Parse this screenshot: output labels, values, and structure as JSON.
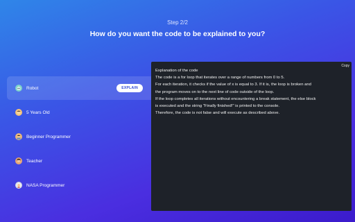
{
  "header": {
    "step": "Step 2/2",
    "question": "How do you want the code to be explained to you?"
  },
  "options": [
    {
      "label": "Robot",
      "icon": "robot-icon",
      "active": true
    },
    {
      "label": "5 Years Old",
      "icon": "child-icon",
      "active": false
    },
    {
      "label": "Beginner Programmer",
      "icon": "beginner-programmer-icon",
      "active": false
    },
    {
      "label": "Teacher",
      "icon": "teacher-icon",
      "active": false
    },
    {
      "label": "NASA Programmer",
      "icon": "astronaut-icon",
      "active": false
    }
  ],
  "explain_button": "EXPLAIN",
  "panel": {
    "copy_label": "Copy",
    "lines": [
      "Explanation of the code",
      "The code is a for loop that iterates over a range of numbers from 0 to 5.",
      "For each iteration, it checks if the value of x is equal to 3. If it is, the loop is broken and",
      "the program moves on to the next line of code outside of the loop.",
      "If the loop completes all iterations without encountering a break statement, the else block",
      "is executed and the string \"Finally finished!\" is printed to the console.",
      "Therefore, the code is not false and will execute as described above."
    ]
  },
  "colors": {
    "background_start": "#2f86e8",
    "background_end": "#3b1bcc",
    "panel": "#1e2229",
    "button_text": "#2b45d6"
  }
}
